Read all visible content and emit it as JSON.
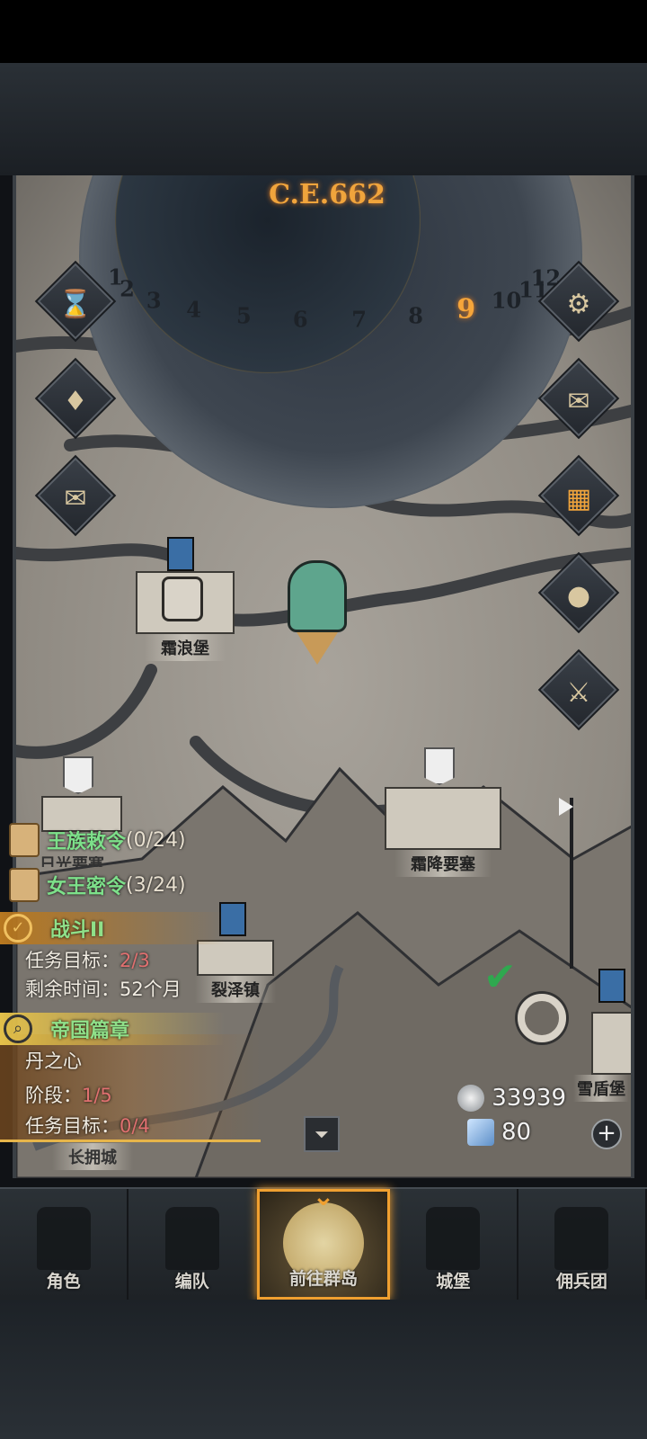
{
  "calendar": {
    "year": "C.E.662",
    "months": [
      "1",
      "2",
      "3",
      "4",
      "5",
      "6",
      "7",
      "8",
      "9",
      "10",
      "11",
      "12"
    ],
    "current_month": "9"
  },
  "side_buttons_left": [
    {
      "name": "hourglass-icon"
    },
    {
      "name": "money-bag-icon"
    },
    {
      "name": "scroll-icon"
    }
  ],
  "side_buttons_right": [
    {
      "name": "settings-gear-icon"
    },
    {
      "name": "mail-icon"
    },
    {
      "name": "grid-window-icon"
    },
    {
      "name": "coin-icon"
    },
    {
      "name": "helmet-sword-icon"
    }
  ],
  "locations": {
    "shuanglang": "霜浪堡",
    "shuangjiang": "霜降要塞",
    "lieze": "裂泽镇",
    "xuedun": "雪盾堡",
    "changyong": "长拥城",
    "partial": "日光要塞"
  },
  "quests": [
    {
      "title": "王族敕令",
      "count": "(0/24)"
    },
    {
      "title": "女王密令",
      "count": "(3/24)"
    }
  ],
  "battle_panel": {
    "title": "战斗II",
    "target_label": "任务目标：",
    "target_value": "2/3",
    "time_label": "剩余时间：",
    "time_value": "52个月"
  },
  "chapter_panel": {
    "title": "帝国篇章",
    "subtitle": "丹之心",
    "stage_label": "阶段：",
    "stage_value": "1/5",
    "target_label": "任务目标：",
    "target_value": "0/4"
  },
  "currency": {
    "silver": "33939",
    "crystal": "80"
  },
  "nav": [
    {
      "label": "角色",
      "active": false
    },
    {
      "label": "编队",
      "active": false
    },
    {
      "label": "前往群岛",
      "active": true
    },
    {
      "label": "城堡",
      "active": false
    },
    {
      "label": "佣兵团",
      "active": false
    }
  ],
  "colors": {
    "accent": "#f0a43c",
    "quest_green": "#7de08a",
    "progress_red": "#e07070"
  }
}
